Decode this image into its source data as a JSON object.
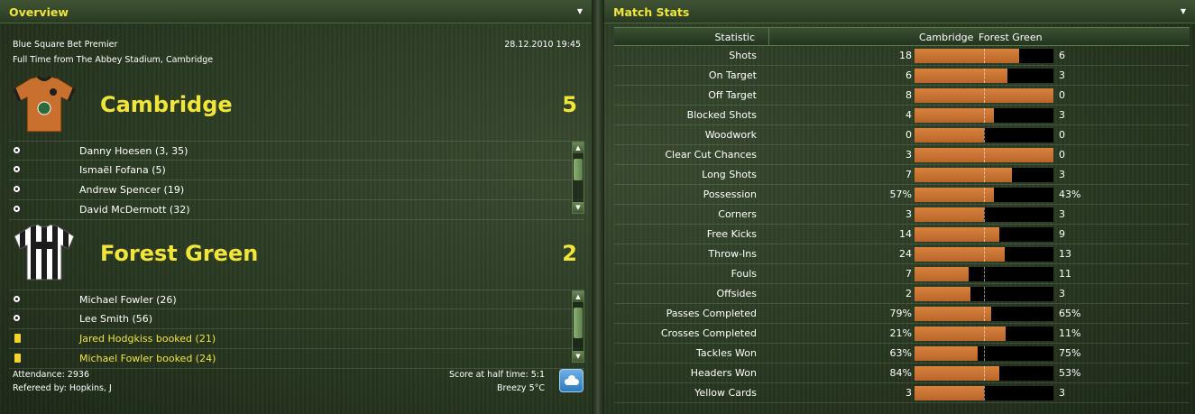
{
  "overview": {
    "title": "Overview",
    "competition": "Blue Square Bet Premier",
    "datetime": "28.12.2010 19:45",
    "result_line": "Full Time from The Abbey Stadium, Cambridge",
    "home": {
      "name": "Cambridge",
      "score": "5",
      "kit_colors": [
        "#c8702e",
        "#1e1e1e"
      ],
      "events": [
        {
          "type": "goal",
          "icon": "ball-icon",
          "text": "Danny Hoesen (3, 35)"
        },
        {
          "type": "goal",
          "icon": "ball-icon",
          "text": "Ismaël Fofana (5)"
        },
        {
          "type": "goal",
          "icon": "ball-icon",
          "text": "Andrew Spencer (19)"
        },
        {
          "type": "goal",
          "icon": "ball-icon",
          "text": "David McDermott (32)"
        }
      ]
    },
    "away": {
      "name": "Forest Green",
      "score": "2",
      "kit_colors": [
        "#1c1c1c",
        "#ffffff"
      ],
      "events": [
        {
          "type": "goal",
          "icon": "ball-icon",
          "text": "Michael Fowler (26)"
        },
        {
          "type": "goal",
          "icon": "ball-icon",
          "text": "Lee Smith (56)"
        },
        {
          "type": "booking",
          "icon": "yellow-card-icon",
          "text": "Jared Hodgkiss booked (21)"
        },
        {
          "type": "booking",
          "icon": "yellow-card-icon",
          "text": "Michael Fowler booked (24)"
        }
      ]
    },
    "attendance": "Attendance: 2936",
    "referee": "Refereed by: Hopkins, J",
    "half_time": "Score at half time: 5:1",
    "weather": "Breezy 5°C"
  },
  "stats": {
    "title": "Match Stats",
    "header": {
      "statistic": "Statistic",
      "home": "Cambridge",
      "away": "Forest Green"
    },
    "rows": [
      {
        "label": "Shots",
        "home": "18",
        "away": "6",
        "home_share": 0.75
      },
      {
        "label": "On Target",
        "home": "6",
        "away": "3",
        "home_share": 0.667
      },
      {
        "label": "Off Target",
        "home": "8",
        "away": "0",
        "home_share": 1.0
      },
      {
        "label": "Blocked Shots",
        "home": "4",
        "away": "3",
        "home_share": 0.571
      },
      {
        "label": "Woodwork",
        "home": "0",
        "away": "0",
        "home_share": 0.5
      },
      {
        "label": "Clear Cut Chances",
        "home": "3",
        "away": "0",
        "home_share": 1.0
      },
      {
        "label": "Long Shots",
        "home": "7",
        "away": "3",
        "home_share": 0.7
      },
      {
        "label": "Possession",
        "home": "57%",
        "away": "43%",
        "home_share": 0.57
      },
      {
        "label": "Corners",
        "home": "3",
        "away": "3",
        "home_share": 0.5
      },
      {
        "label": "Free Kicks",
        "home": "14",
        "away": "9",
        "home_share": 0.609
      },
      {
        "label": "Throw-Ins",
        "home": "24",
        "away": "13",
        "home_share": 0.649
      },
      {
        "label": "Fouls",
        "home": "7",
        "away": "11",
        "home_share": 0.389
      },
      {
        "label": "Offsides",
        "home": "2",
        "away": "3",
        "home_share": 0.4
      },
      {
        "label": "Passes Completed",
        "home": "79%",
        "away": "65%",
        "home_share": 0.549
      },
      {
        "label": "Crosses Completed",
        "home": "21%",
        "away": "11%",
        "home_share": 0.656
      },
      {
        "label": "Tackles Won",
        "home": "63%",
        "away": "75%",
        "home_share": 0.457
      },
      {
        "label": "Headers Won",
        "home": "84%",
        "away": "53%",
        "home_share": 0.613
      },
      {
        "label": "Yellow Cards",
        "home": "3",
        "away": "3",
        "home_share": 0.5
      }
    ]
  },
  "colors": {
    "accent": "#f2e53a",
    "bar_home": "#c8702e",
    "bar_away": "#000000"
  }
}
